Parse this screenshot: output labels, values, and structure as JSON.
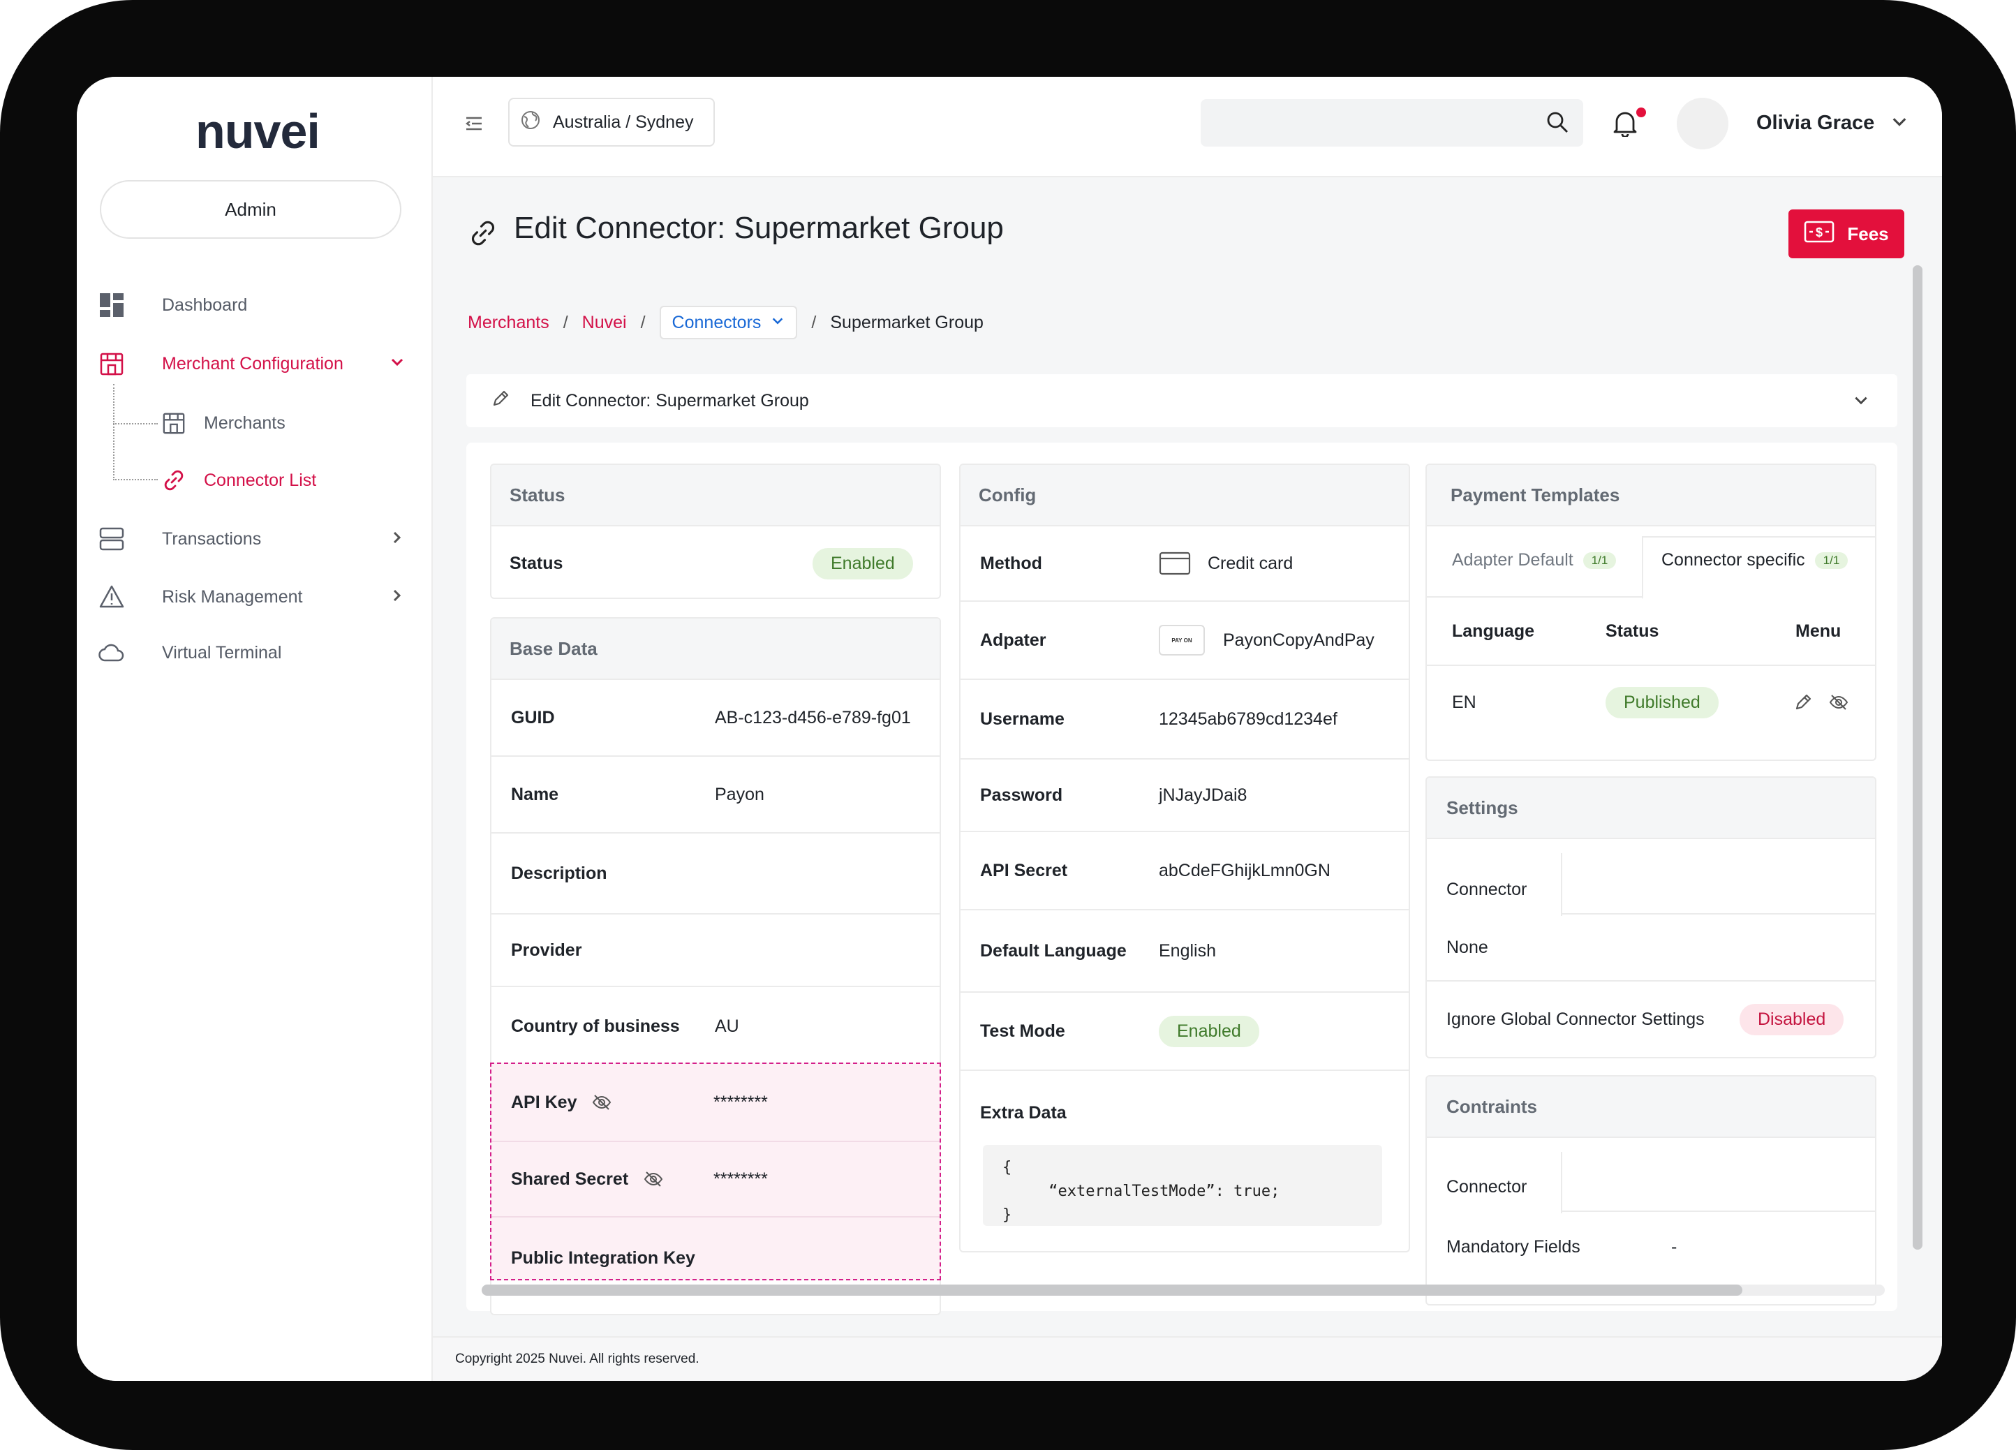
{
  "brand": {
    "logo_text": "nuvei",
    "accent": "#d31048",
    "primary_red": "#e3103c"
  },
  "sidebar": {
    "role_button": "Admin",
    "items": [
      {
        "label": "Dashboard",
        "icon": "dashboard-icon"
      },
      {
        "label": "Merchant Configuration",
        "icon": "store-icon",
        "active": true,
        "expanded": true
      },
      {
        "label": "Transactions",
        "icon": "transactions-icon"
      },
      {
        "label": "Risk Management",
        "icon": "warning-icon"
      },
      {
        "label": "Virtual Terminal",
        "icon": "cloud-icon"
      }
    ],
    "subitems": [
      {
        "label": "Merchants",
        "icon": "store-icon"
      },
      {
        "label": "Connector List",
        "icon": "link-icon",
        "active": true
      }
    ]
  },
  "topbar": {
    "location": "Australia / Sydney",
    "search_placeholder": "",
    "user_name": "Olivia Grace"
  },
  "page": {
    "title": "Edit Connector: Supermarket Group",
    "fees_label": "Fees"
  },
  "breadcrumb": {
    "items": [
      "Merchants",
      "Nuvei"
    ],
    "select_label": "Connectors",
    "current": "Supermarket Group"
  },
  "accordion": {
    "label": "Edit Connector: Supermarket Group"
  },
  "status_card": {
    "title": "Status",
    "label": "Status",
    "value": "Enabled"
  },
  "base_data": {
    "title": "Base Data",
    "rows": [
      {
        "label": "GUID",
        "value": "AB-c123-d456-e789-fg01"
      },
      {
        "label": "Name",
        "value": "Payon"
      },
      {
        "label": "Description",
        "value": ""
      },
      {
        "label": "Provider",
        "value": ""
      },
      {
        "label": "Country of business",
        "value": "AU"
      },
      {
        "label": "API Key",
        "value": "********"
      },
      {
        "label": "Shared Secret",
        "value": "********"
      },
      {
        "label": "Public Integration Key",
        "value": ""
      }
    ]
  },
  "config": {
    "title": "Config",
    "rows": [
      {
        "label": "Method",
        "value": "Credit card"
      },
      {
        "label": "Adpater",
        "value": "PayonCopyAndPay",
        "logo_text": "PAY ON"
      },
      {
        "label": "Username",
        "value": "12345ab6789cd1234ef"
      },
      {
        "label": "Password",
        "value": "jNJayJDai8"
      },
      {
        "label": "API Secret",
        "value": "abCdeFGhijkLmn0GN"
      },
      {
        "label": "Default Language",
        "value": "English"
      },
      {
        "label": "Test Mode",
        "value": "Enabled"
      }
    ],
    "extra_data_label": "Extra Data",
    "extra_data_code": "{\n     “externalTestMode”: true;\n}"
  },
  "payment_templates": {
    "title": "Payment Templates",
    "tabs": [
      {
        "label": "Adapter Default",
        "count": "1/1"
      },
      {
        "label": "Connector specific",
        "count": "1/1",
        "active": true
      }
    ],
    "columns": [
      "Language",
      "Status",
      "Menu"
    ],
    "rows": [
      {
        "language": "EN",
        "status": "Published"
      }
    ]
  },
  "settings": {
    "title": "Settings",
    "tab": "Connector",
    "value": "None",
    "ignore_label": "Ignore Global Connector Settings",
    "ignore_value": "Disabled"
  },
  "constraints": {
    "title": "Contraints",
    "tab": "Connector",
    "mandatory_label": "Mandatory Fields",
    "mandatory_value": "-"
  },
  "footer": {
    "copyright": "Copyright 2025 Nuvei. All rights reserved."
  }
}
